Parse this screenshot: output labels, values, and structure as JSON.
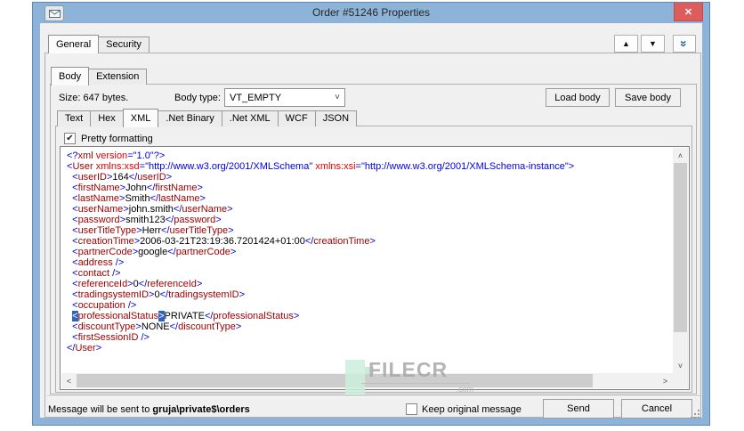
{
  "titlebar": {
    "title": "Order #51246 Properties"
  },
  "icons": {
    "envelope": "envelope-icon",
    "close": "✕",
    "nav_up": "▲",
    "nav_down": "▼",
    "collapse": "»",
    "combo_chevron": "˅",
    "check": "✔",
    "scroll_up": "˄",
    "scroll_down": "˅",
    "scroll_left": "˂",
    "scroll_right": "˃"
  },
  "outer_tabs": {
    "items": [
      "General",
      "Security"
    ],
    "active": "General"
  },
  "inner_tabs": {
    "items": [
      "Body",
      "Extension"
    ],
    "active": "Body"
  },
  "body_info": {
    "size_label": "Size: 647 bytes.",
    "body_type_label": "Body type:",
    "body_type_value": "VT_EMPTY"
  },
  "actions": {
    "load_body": "Load body",
    "save_body": "Save body",
    "send": "Send",
    "cancel": "Cancel"
  },
  "format_tabs": {
    "items": [
      "Text",
      "Hex",
      "XML",
      ".Net Binary",
      ".Net XML",
      "WCF",
      "JSON"
    ],
    "active": "XML"
  },
  "pretty_formatting": {
    "label": "Pretty formatting",
    "checked": true
  },
  "xml_view": {
    "bracket_highlight_line": 15,
    "lines": [
      "<?xml version=\"1.0\"?>",
      "<User xmlns:xsd=\"http://www.w3.org/2001/XMLSchema\" xmlns:xsi=\"http://www.w3.org/2001/XMLSchema-instance\">",
      "  <userID>164</userID>",
      "  <firstName>John</firstName>",
      "  <lastName>Smith</lastName>",
      "  <userName>john.smith</userName>",
      "  <password>smith123</password>",
      "  <userTitleType>Herr</userTitleType>",
      "  <creationTime>2006-03-21T23:19:36.7201424+01:00</creationTime>",
      "  <partnerCode>google</partnerCode>",
      "  <address />",
      "  <contact />",
      "  <referenceId>0</referenceId>",
      "  <tradingsystemID>0</tradingsystemID>",
      "  <occupation />",
      "  <professionalStatus>PRIVATE</professionalStatus>",
      "  <discountType>NONE</discountType>",
      "  <firstSessionID />",
      "</User>"
    ]
  },
  "footer": {
    "message_prefix": "Message will be sent to",
    "destination": "gruja\\private$\\orders",
    "keep_label": "Keep original message",
    "keep_checked": false
  },
  "watermark": {
    "text": "FILECR",
    "suffix": ".com"
  },
  "colors": {
    "titlebar": "#8db4d8",
    "close_button": "#dd5c5c",
    "dialog_bg": "#f0f0f0",
    "xml_tag": "#990000",
    "xml_attr": "#e00000",
    "xml_punct": "#0000e0",
    "bracket_highlight_bg": "#2f63c1",
    "collapse_icon": "#2c5fa8"
  }
}
